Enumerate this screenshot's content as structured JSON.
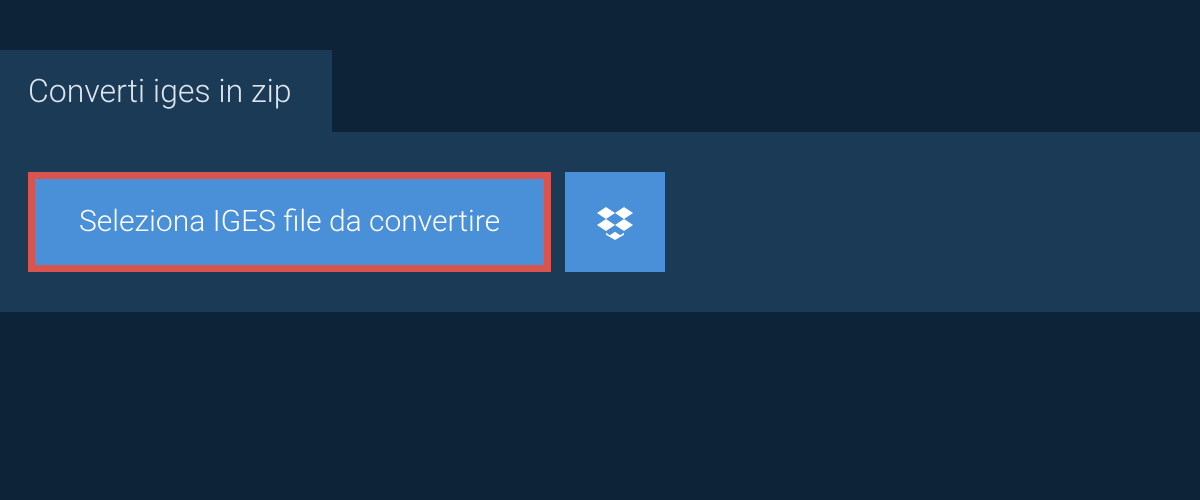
{
  "tab": {
    "title": "Converti iges in zip"
  },
  "actions": {
    "select_file_label": "Seleziona IGES file da convertire"
  }
}
